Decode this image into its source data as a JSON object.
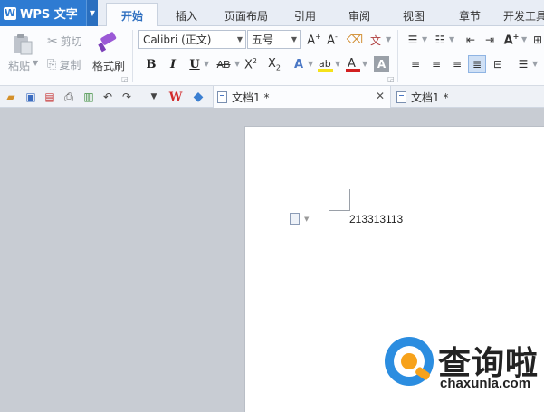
{
  "app": {
    "name": "WPS 文字"
  },
  "tabs": [
    {
      "label": "开始",
      "active": true
    },
    {
      "label": "插入"
    },
    {
      "label": "页面布局"
    },
    {
      "label": "引用"
    },
    {
      "label": "审阅"
    },
    {
      "label": "视图"
    },
    {
      "label": "章节"
    },
    {
      "label": "开发工具"
    }
  ],
  "ribbon": {
    "clipboard": {
      "paste_label": "粘贴",
      "cut_label": "剪切",
      "copy_label": "复制",
      "format_painter_label": "格式刷"
    },
    "font": {
      "family": "Calibri (正文)",
      "size": "五号"
    }
  },
  "quick_access": {
    "doc_tabs": [
      {
        "title": "文档1 *",
        "active": true
      },
      {
        "title": "文档1 *",
        "active": false
      }
    ]
  },
  "document": {
    "body_text": "213313113"
  },
  "watermark": {
    "brand": "查询啦",
    "url": "chaxunla.com"
  },
  "colors": {
    "accent": "#2e7bd2",
    "tab_active_text": "#2e6fc0",
    "highlight": "#f5e21b",
    "font_color_bar": "#d22020"
  }
}
